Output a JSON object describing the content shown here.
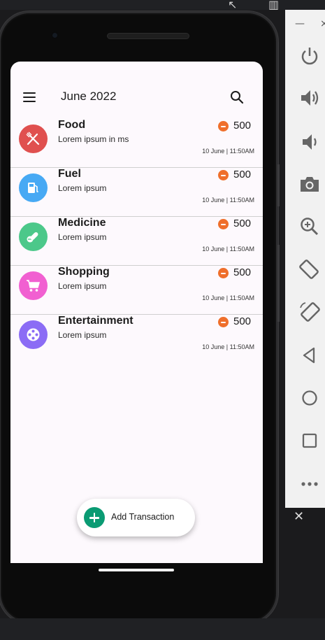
{
  "header": {
    "title": "June 2022"
  },
  "transactions": [
    {
      "name": "Food",
      "description": "Lorem ipsum in ms",
      "amount": "500",
      "date": "10 June | 11:50AM",
      "color": "#e0504f",
      "icon": "fork-knife-icon"
    },
    {
      "name": "Fuel",
      "description": "Lorem ipsum",
      "amount": "500",
      "date": "10 June | 11:50AM",
      "color": "#47a9f4",
      "icon": "fuel-pump-icon"
    },
    {
      "name": "Medicine",
      "description": "Lorem ipsum",
      "amount": "500",
      "date": "10 June | 11:50AM",
      "color": "#4cc88a",
      "icon": "pill-icon"
    },
    {
      "name": "Shopping",
      "description": "Lorem ipsum",
      "amount": "500",
      "date": "10 June | 11:50AM",
      "color": "#f160d1",
      "icon": "cart-icon"
    },
    {
      "name": "Entertainment",
      "description": "Lorem ipsum",
      "amount": "500",
      "date": "10 June | 11:50AM",
      "color": "#8b6cf5",
      "icon": "film-reel-icon"
    }
  ],
  "fab": {
    "label": "Add Transaction",
    "color": "#0a9b73"
  },
  "colors": {
    "expense_badge": "#ef6f2b",
    "screen_bg": "#fdf9fd"
  },
  "emulator_toolbar": [
    "power-icon",
    "volume-up-icon",
    "volume-down-icon",
    "camera-icon",
    "zoom-icon",
    "rotate-left-icon",
    "rotate-right-icon",
    "back-icon",
    "home-icon",
    "overview-icon",
    "more-icon"
  ]
}
